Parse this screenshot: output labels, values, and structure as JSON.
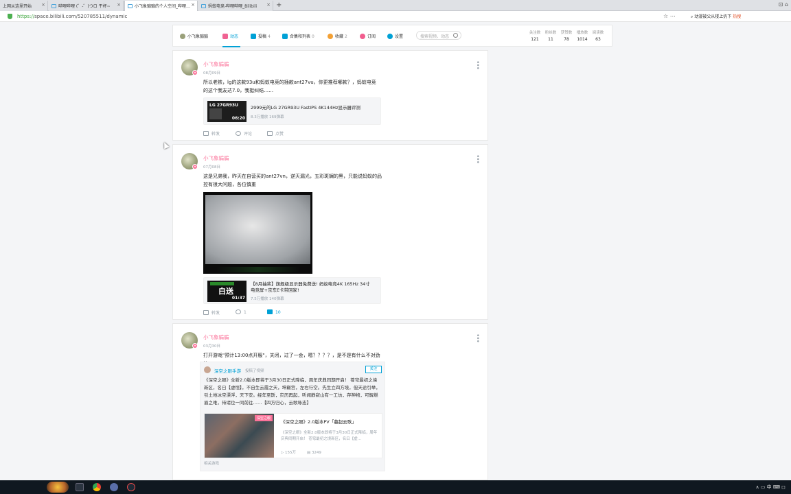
{
  "browser": {
    "tabs": [
      {
        "label": "上网从这里开始",
        "active": false
      },
      {
        "label": "哔哩哔哩 (゜-゜)つロ 干杯~",
        "active": false
      },
      {
        "label": "小飞象骟骟的个人空间_哔哩…",
        "active": true
      },
      {
        "label": "蚂蚁电竞-哔哩哔哩_Bilibili",
        "active": false
      }
    ],
    "new_tab_label": "+",
    "url_scheme": "https://",
    "url_rest": "space.bilibili.com/520785511/dynamic",
    "toolbar_icons": "☆ ⋯",
    "search_hint": "动漫被父从楼上扔下",
    "search_hot": "热搜",
    "window_controls": "⊡  ⌂"
  },
  "header": {
    "username": "小飞象骟骟",
    "nav": [
      {
        "label": "动态",
        "count": "",
        "icon": "dynamic-icon",
        "color": "#f06292"
      },
      {
        "label": "投稿",
        "count": "4",
        "icon": "upload-icon",
        "color": "#00a1d6"
      },
      {
        "label": "合集和列表",
        "count": "0",
        "icon": "collection-icon",
        "color": "#00a1d6"
      },
      {
        "label": "收藏",
        "count": "2",
        "icon": "star-icon",
        "color": "#f3a034"
      },
      {
        "label": "订阅",
        "count": "",
        "icon": "heart-icon",
        "color": "#f25d8e"
      },
      {
        "label": "设置",
        "count": "",
        "icon": "gear-icon",
        "color": "#00a1d6"
      }
    ],
    "search_placeholder": "搜索视频、动态",
    "stats": [
      {
        "label": "关注数",
        "value": "121"
      },
      {
        "label": "粉丝数",
        "value": "11"
      },
      {
        "label": "获赞数",
        "value": "78"
      },
      {
        "label": "播放数",
        "value": "1014"
      },
      {
        "label": "阅读数",
        "value": "63"
      }
    ]
  },
  "posts": [
    {
      "author": "小飞象骟骟",
      "date": "08月09日",
      "text": "所以老铁，lg的这款93u和蚂蚁电竞的插款ant27vu，你更推荐哪款？，蚂蚁电竞的这个我友达7.0，我挺纠结……",
      "video": {
        "thumb_text": "LG 27GR93U",
        "duration": "06:20",
        "title": "2999元的LG 27GR93U FastIPS 4K144Hz显示器评测",
        "meta": "8.3万播放 169弹幕"
      },
      "actions": {
        "share": "转发",
        "comment": "评论",
        "like": "点赞"
      }
    },
    {
      "author": "小飞象骟骟",
      "date": "07月08日",
      "text": "这是兄弟我，昨天在自营买的ant27vn，逆天漏光，五彩斑斓的黑，只能说蚂蚁的品控有很大问题，各位慎重",
      "video": {
        "thumb_text": "白送",
        "duration": "01:37",
        "title": "【8月抽奖】旗舰级显示器免费送! 蚂蚁电竞4K 165Hz 34寸电竞屏+京东E卡带回家!",
        "meta": "7.5万播放 140弹幕"
      },
      "actions": {
        "share": "转发",
        "comment": "1",
        "like": "10"
      }
    },
    {
      "author": "小飞象骟骟",
      "date": "03月30日",
      "text": "打开游戏\"预计13:00点开服\"，关闭，过了一会，嗯？？？？，是不是有什么不对劲的",
      "forward": {
        "author": "深空之眼手游",
        "action": "投稿了视频",
        "follow": "关注",
        "text": "《深空之眼》全新2.0版本即将于3月30日正式降临，周年庆典同期开启！ 苍穹最初之境新区，名曰【虚恒】，不自生云霞之天，坤巅宫，左右行空。先生立四方境，但天途引举，引土地冰空漂浮，天下安。经年至斯，灾历再起，听闻静寂山有一工坊，存神物，可解燃眉之难，待诸位一同前往……【四方归心，云歌咏志】",
        "badge": "深空之眼",
        "video_title": "《深空之眼》2.0版本PV「暮起云歌」",
        "video_desc": "《深空之眼》全新2.0版本即将于3月30日正式降临，周年庆典同期开启！ 苍穹最初之境新区，名曰【虚…",
        "plays": "155万",
        "danmaku": "3249",
        "tag": "相关游戏"
      }
    }
  ],
  "taskbar": {
    "tray_text": "∧ ▭ 中 ⌨ ◻"
  }
}
